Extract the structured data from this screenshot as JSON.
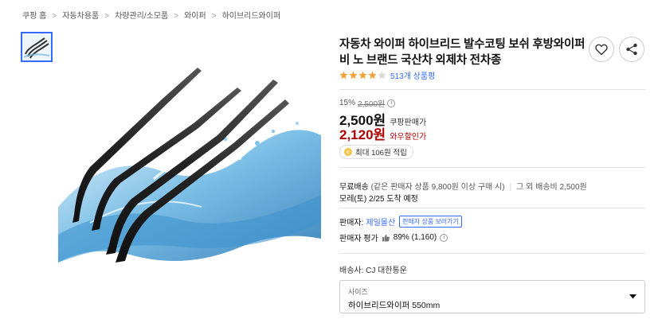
{
  "breadcrumb": {
    "items": [
      "쿠팡 홈",
      "자동차용품",
      "차량관리/소모품",
      "와이퍼",
      "하이브리드와이퍼"
    ],
    "separator": ">"
  },
  "product": {
    "title": "자동차 와이퍼 하이브리드 발수코팅 보쉬 후방와이퍼 비 노 브랜드 국산차 외제차 전차종",
    "rating_stars": 4,
    "rating_max": 5,
    "rating_count_text": "513개 상품평"
  },
  "price": {
    "discount_percent": "15%",
    "original_price": "2,500원",
    "info_icon": "i",
    "sale_price": "2,500원",
    "sale_label": "쿠팡판매가",
    "wow_price": "2,120원",
    "wow_label": "와우할인가"
  },
  "cash": {
    "coin_symbol": "c",
    "text": "최대 106원 적립"
  },
  "shipping": {
    "free_label": "무료배송",
    "condition": "(같은 판매자 상품 9,800원 이상 구매 시)",
    "other": "그 외 배송비 2,500원",
    "arrival": "모레(토) 2/25 도착 예정"
  },
  "seller": {
    "label": "판매자:",
    "name": "제일몰산",
    "other_products_button": "판매자 상품 보러가기",
    "rating_label": "판매자 평가",
    "rating_value": "89% (1,160)",
    "info_icon": "i"
  },
  "delivery": {
    "carrier_text": "배송사: CJ 대한통운"
  },
  "option": {
    "label": "사이즈",
    "value": "하이브리드와이퍼 550mm"
  },
  "icons": {
    "favorite": "heart-icon",
    "share": "share-icon",
    "dropdown": "chevron-down-icon",
    "thumbs": "thumbs-up-icon"
  },
  "colors": {
    "link_blue": "#346aff",
    "price_red": "#ae0000",
    "star_orange": "#f2a43a"
  }
}
